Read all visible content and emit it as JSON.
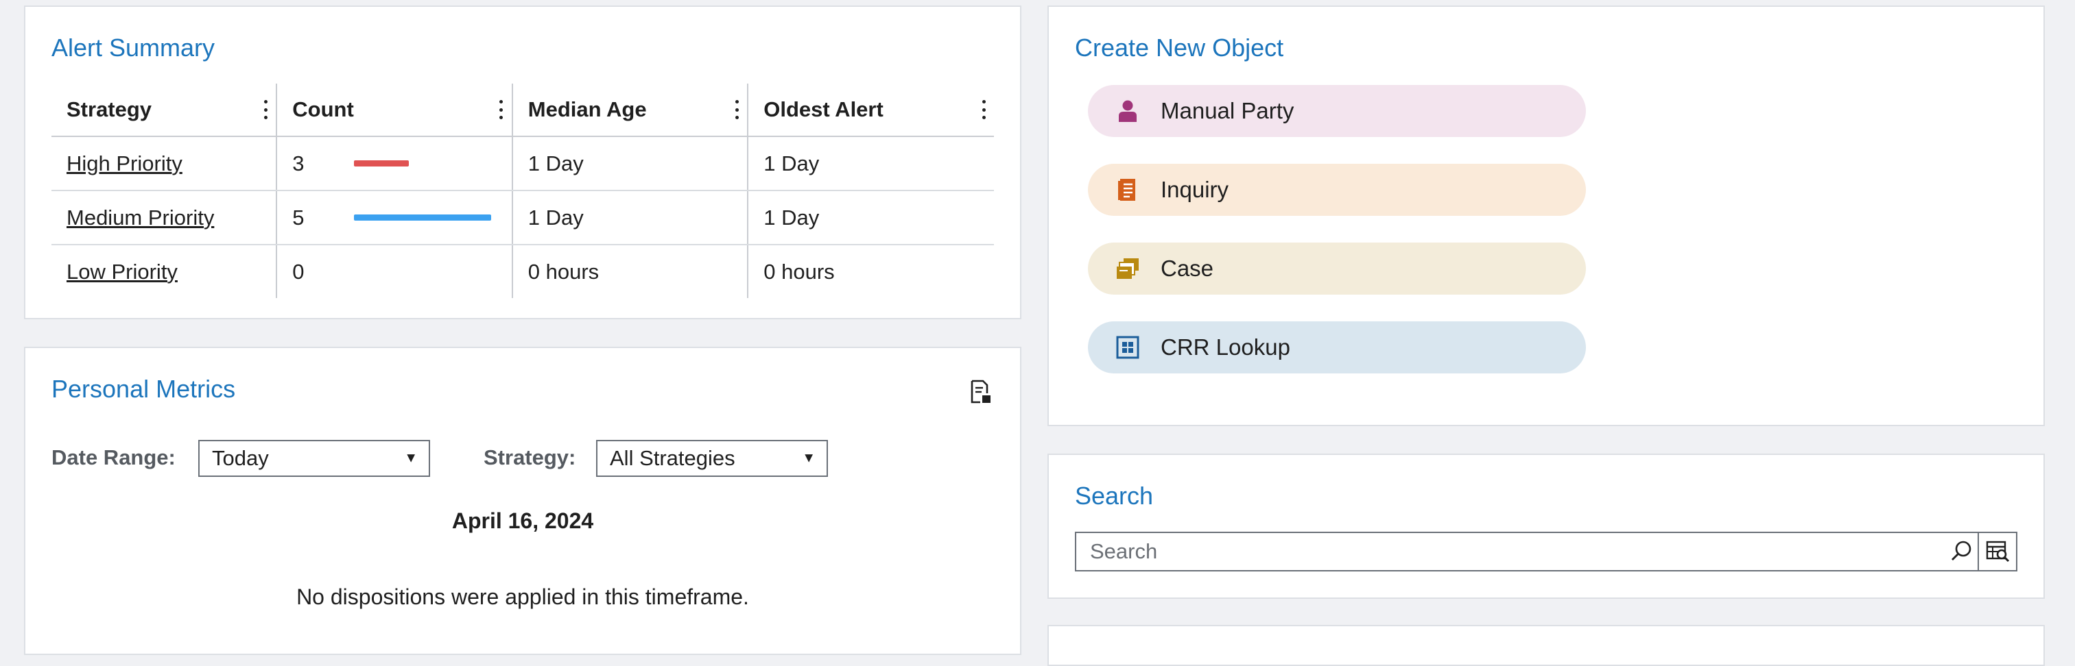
{
  "alert_summary": {
    "title": "Alert Summary",
    "columns": [
      "Strategy",
      "Count",
      "Median Age",
      "Oldest Alert"
    ],
    "rows": [
      {
        "strategy": "High Priority",
        "count": "3",
        "count_bar_fraction": 0.4,
        "bar_color": "#e05252",
        "median_age": "1 Day",
        "oldest_alert": "1 Day"
      },
      {
        "strategy": "Medium Priority",
        "count": "5",
        "count_bar_fraction": 1.0,
        "bar_color": "#3ba1f0",
        "median_age": "1 Day",
        "oldest_alert": "1 Day"
      },
      {
        "strategy": "Low Priority",
        "count": "0",
        "count_bar_fraction": 0,
        "bar_color": "#3ba1f0",
        "median_age": "0 hours",
        "oldest_alert": "0 hours"
      }
    ]
  },
  "personal_metrics": {
    "title": "Personal Metrics",
    "export_icon": "export-report-icon",
    "date_range_label": "Date Range:",
    "date_range_value": "Today",
    "strategy_label": "Strategy:",
    "strategy_value": "All Strategies",
    "date_heading": "April 16, 2024",
    "empty_message": "No dispositions were applied in this timeframe."
  },
  "create_new_object": {
    "title": "Create New Object",
    "items": [
      {
        "label": "Manual Party",
        "icon": "person-icon",
        "bg": "#f3e4ee",
        "icon_color": "#a0357a"
      },
      {
        "label": "Inquiry",
        "icon": "document-icon",
        "bg": "#faead9",
        "icon_color": "#d45f1a"
      },
      {
        "label": "Case",
        "icon": "folder-icon",
        "bg": "#f3ecda",
        "icon_color": "#b98a10"
      },
      {
        "label": "CRR Lookup",
        "icon": "lookup-grid-icon",
        "bg": "#d9e6ef",
        "icon_color": "#1b5d9a"
      }
    ]
  },
  "search": {
    "title": "Search",
    "placeholder": "Search",
    "search_icon": "magnifier-icon",
    "advanced_icon": "advanced-search-icon"
  },
  "colors": {
    "accent": "#1c75bc",
    "page_bg": "#f0f1f4"
  }
}
